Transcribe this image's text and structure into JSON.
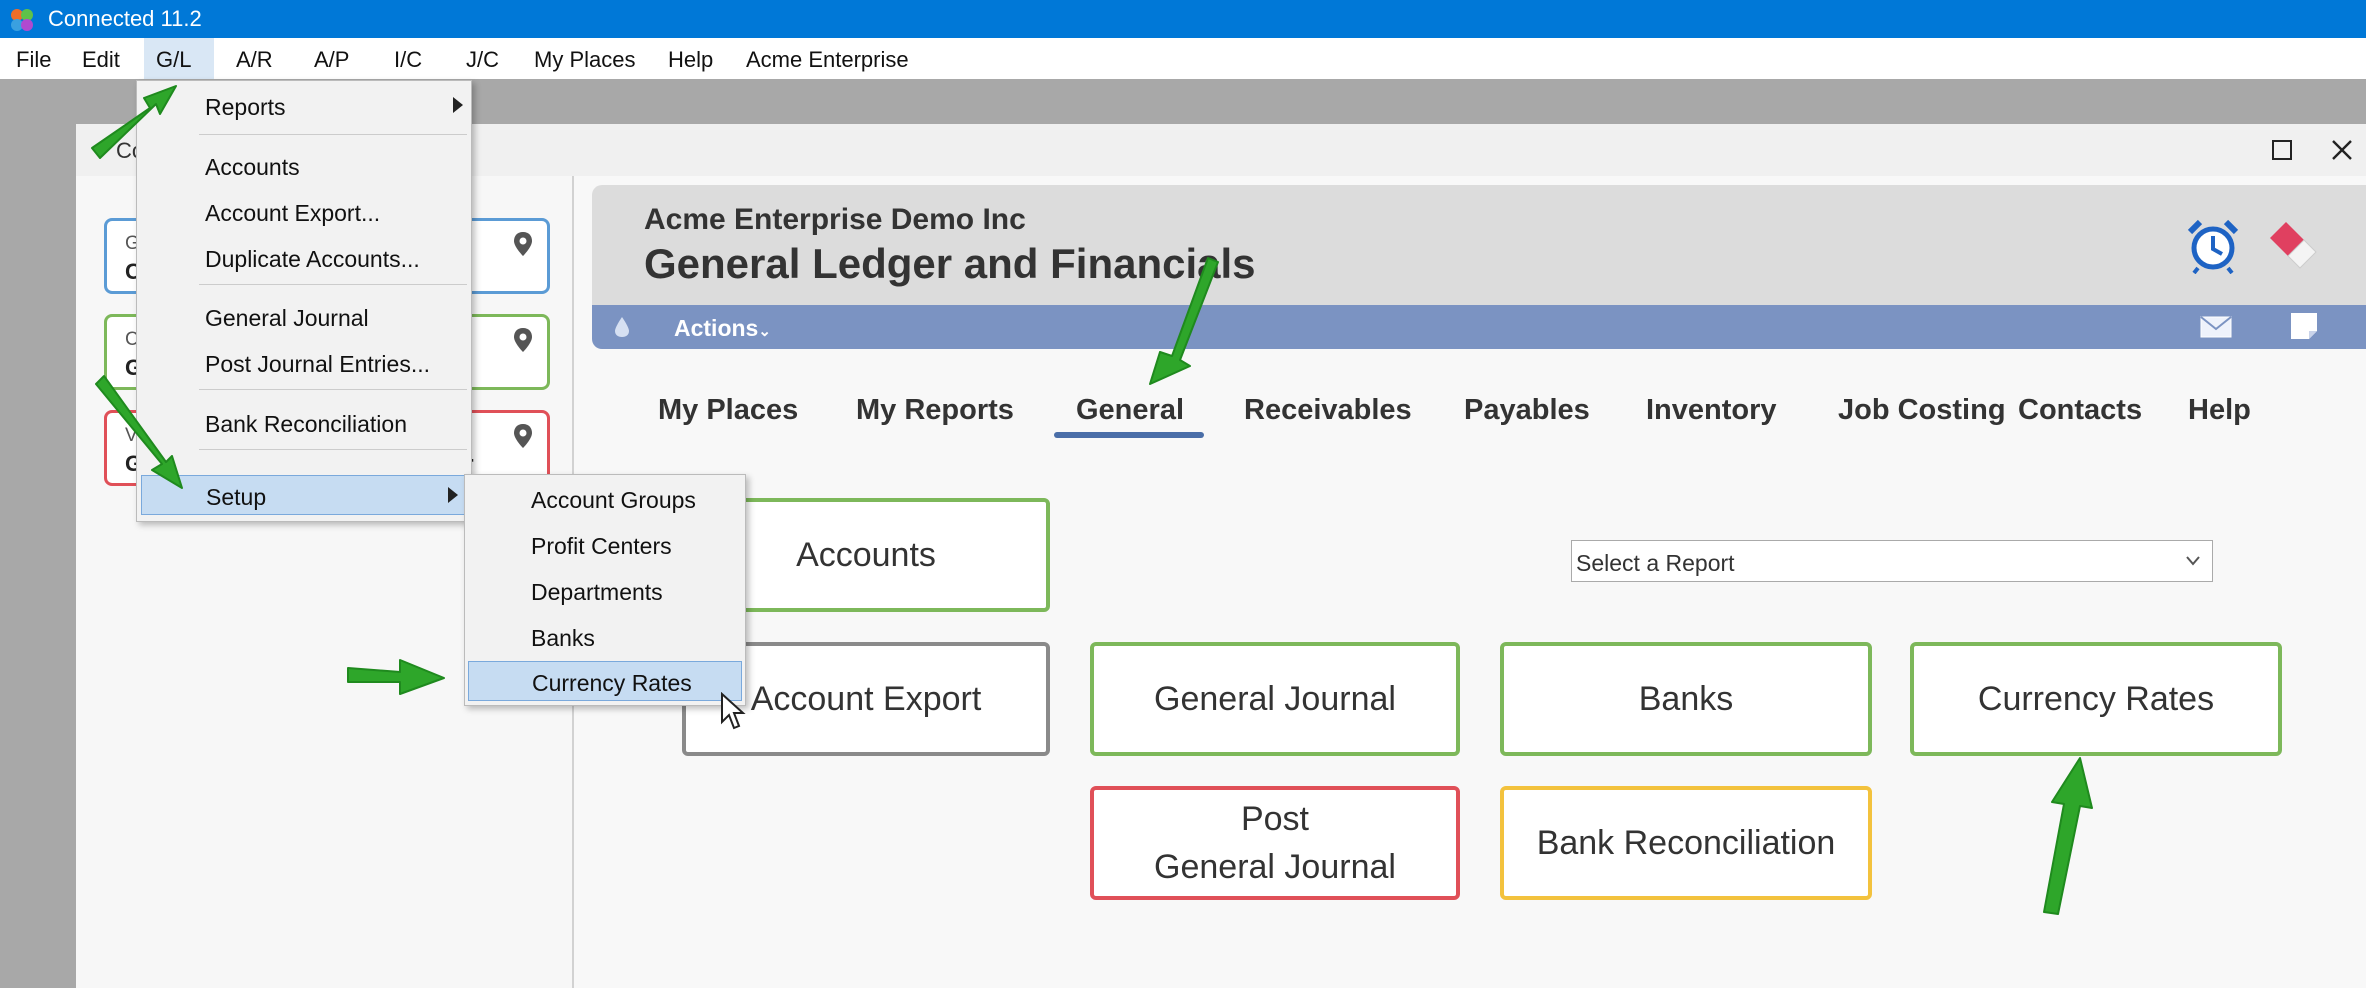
{
  "window": {
    "title": "Connected 11.2"
  },
  "menubar": {
    "items": [
      "File",
      "Edit",
      "G/L",
      "A/R",
      "A/P",
      "I/C",
      "J/C",
      "My Places",
      "Help",
      "Acme Enterprise"
    ]
  },
  "inner_window": {
    "title_fragment": "Co"
  },
  "gl_menu": {
    "reports": "Reports",
    "accounts": "Accounts",
    "account_export": "Account Export...",
    "duplicate_accounts": "Duplicate Accounts...",
    "general_journal": "General Journal",
    "post_journal_entries": "Post Journal Entries...",
    "bank_reconciliation": "Bank Reconciliation",
    "setup": "Setup"
  },
  "setup_submenu": {
    "account_groups": "Account Groups",
    "profit_centers": "Profit Centers",
    "departments": "Departments",
    "banks": "Banks",
    "currency_rates": "Currency Rates"
  },
  "favorites": [
    {
      "line1": "G",
      "line2": "C",
      "color": "#5b9bd5"
    },
    {
      "line1": "C",
      "line2": "G",
      "color": "#7db85a"
    },
    {
      "line1": "V",
      "line2": "G",
      "tail": "r",
      "color": "#e05058"
    }
  ],
  "header": {
    "company": "Acme Enterprise Demo Inc",
    "title": "General Ledger and Financials",
    "actions": "Actions"
  },
  "tabs": [
    "My Places",
    "My Reports",
    "General",
    "Receivables",
    "Payables",
    "Inventory",
    "Job Costing",
    "Contacts",
    "Help"
  ],
  "active_tab": "General",
  "report_select": {
    "placeholder": "Select a Report"
  },
  "tiles": {
    "accounts": "Accounts",
    "account_export": "Account Export",
    "general_journal": "General Journal",
    "banks": "Banks",
    "currency_rates": "Currency Rates",
    "post_line1": "Post",
    "post_line2": "General Journal",
    "bank_reconciliation": "Bank Reconciliation"
  },
  "colors": {
    "titlebar": "#0078d7",
    "actions_bar": "#7b93c2",
    "menu_highlight": "#c6dcf2",
    "annotation_arrow": "#2ea62a"
  },
  "icons": [
    "app-logo-icon",
    "alarm-clock-icon",
    "eraser-icon",
    "drop-icon",
    "mail-icon",
    "note-icon",
    "map-pin-icon",
    "chevron-down-icon",
    "mouse-cursor-icon",
    "maximize-icon",
    "close-icon"
  ]
}
